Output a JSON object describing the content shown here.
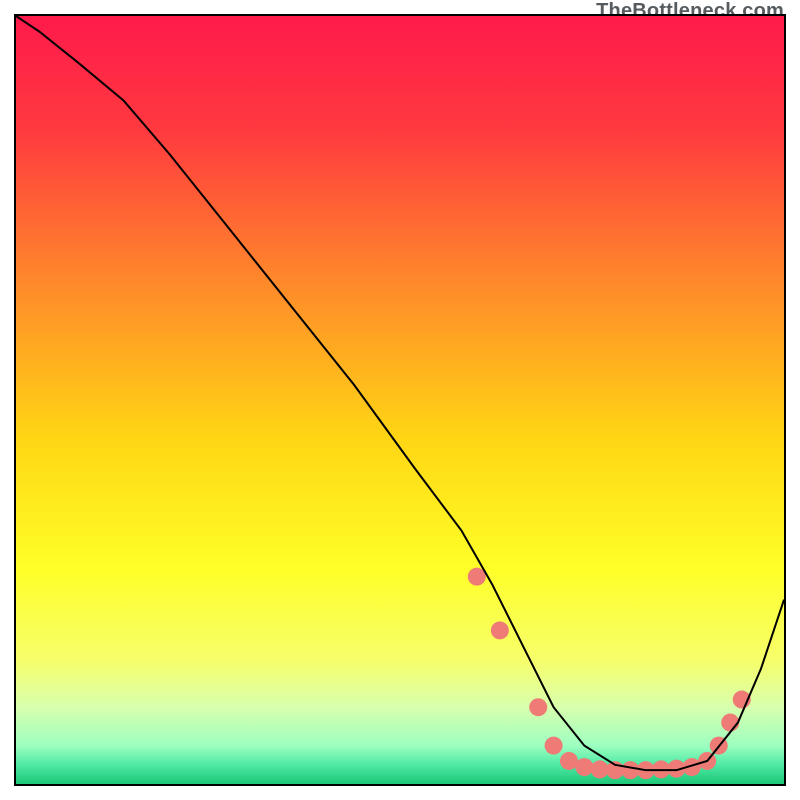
{
  "watermark": "TheBottleneck.com",
  "chart_data": {
    "type": "line",
    "title": "",
    "xlabel": "",
    "ylabel": "",
    "xlim": [
      0,
      100
    ],
    "ylim": [
      0,
      100
    ],
    "background_gradient": {
      "stops": [
        {
          "pos": 0.0,
          "color": "#ff1a4b"
        },
        {
          "pos": 0.15,
          "color": "#ff3a3f"
        },
        {
          "pos": 0.35,
          "color": "#ff8a2a"
        },
        {
          "pos": 0.55,
          "color": "#ffd614"
        },
        {
          "pos": 0.72,
          "color": "#ffff28"
        },
        {
          "pos": 0.84,
          "color": "#f6ff6b"
        },
        {
          "pos": 0.9,
          "color": "#d8ffae"
        },
        {
          "pos": 0.95,
          "color": "#9dffc0"
        },
        {
          "pos": 0.975,
          "color": "#4fe9a5"
        },
        {
          "pos": 1.0,
          "color": "#1cc776"
        }
      ]
    },
    "series": [
      {
        "name": "bottleneck-curve",
        "x": [
          0,
          3,
          8,
          14,
          20,
          28,
          36,
          44,
          52,
          58,
          62,
          66,
          70,
          74,
          78,
          82,
          86,
          90,
          94,
          97,
          100
        ],
        "y": [
          100,
          98,
          94,
          89,
          82,
          72,
          62,
          52,
          41,
          33,
          26,
          18,
          10,
          5,
          2.5,
          1.8,
          1.8,
          3,
          8,
          15,
          24
        ]
      }
    ],
    "markers": {
      "name": "highlight-dots",
      "color": "#ef7b77",
      "radius_px": 9,
      "points": [
        {
          "x": 60,
          "y": 27
        },
        {
          "x": 63,
          "y": 20
        },
        {
          "x": 68,
          "y": 10
        },
        {
          "x": 70,
          "y": 5
        },
        {
          "x": 72,
          "y": 3
        },
        {
          "x": 74,
          "y": 2.2
        },
        {
          "x": 76,
          "y": 1.9
        },
        {
          "x": 78,
          "y": 1.8
        },
        {
          "x": 80,
          "y": 1.8
        },
        {
          "x": 82,
          "y": 1.8
        },
        {
          "x": 84,
          "y": 1.9
        },
        {
          "x": 86,
          "y": 2.0
        },
        {
          "x": 88,
          "y": 2.2
        },
        {
          "x": 90,
          "y": 3.0
        },
        {
          "x": 91.5,
          "y": 5
        },
        {
          "x": 93,
          "y": 8
        },
        {
          "x": 94.5,
          "y": 11
        }
      ]
    }
  }
}
